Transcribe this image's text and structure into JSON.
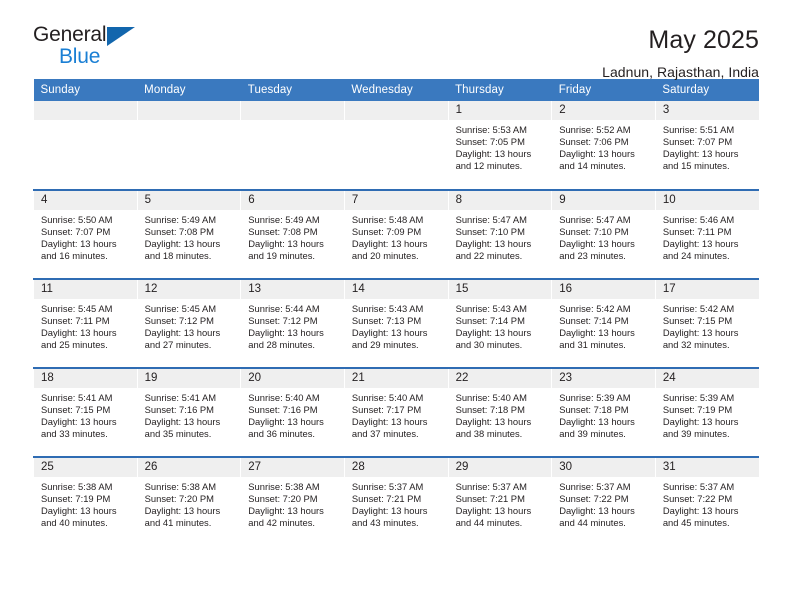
{
  "brand": {
    "name_part1": "General",
    "name_part2": "Blue",
    "accent_color": "#1a7fd4",
    "triangle_color": "#1266ad"
  },
  "header": {
    "title": "May 2025",
    "subtitle": "Ladnun, Rajasthan, India"
  },
  "theme": {
    "header_row_bg": "#3a79bf",
    "week_separator": "#2f6cb3",
    "daynum_bg": "#efefef",
    "text_color": "#231f20"
  },
  "weekday_headers": [
    "Sunday",
    "Monday",
    "Tuesday",
    "Wednesday",
    "Thursday",
    "Friday",
    "Saturday"
  ],
  "weeks": [
    {
      "days": [
        {
          "num": "",
          "sunrise": "",
          "sunset": "",
          "daylight": "",
          "empty": true
        },
        {
          "num": "",
          "sunrise": "",
          "sunset": "",
          "daylight": "",
          "empty": true
        },
        {
          "num": "",
          "sunrise": "",
          "sunset": "",
          "daylight": "",
          "empty": true
        },
        {
          "num": "",
          "sunrise": "",
          "sunset": "",
          "daylight": "",
          "empty": true
        },
        {
          "num": "1",
          "sunrise": "Sunrise: 5:53 AM",
          "sunset": "Sunset: 7:05 PM",
          "daylight": "Daylight: 13 hours and 12 minutes.",
          "empty": false
        },
        {
          "num": "2",
          "sunrise": "Sunrise: 5:52 AM",
          "sunset": "Sunset: 7:06 PM",
          "daylight": "Daylight: 13 hours and 14 minutes.",
          "empty": false
        },
        {
          "num": "3",
          "sunrise": "Sunrise: 5:51 AM",
          "sunset": "Sunset: 7:07 PM",
          "daylight": "Daylight: 13 hours and 15 minutes.",
          "empty": false
        }
      ]
    },
    {
      "days": [
        {
          "num": "4",
          "sunrise": "Sunrise: 5:50 AM",
          "sunset": "Sunset: 7:07 PM",
          "daylight": "Daylight: 13 hours and 16 minutes.",
          "empty": false
        },
        {
          "num": "5",
          "sunrise": "Sunrise: 5:49 AM",
          "sunset": "Sunset: 7:08 PM",
          "daylight": "Daylight: 13 hours and 18 minutes.",
          "empty": false
        },
        {
          "num": "6",
          "sunrise": "Sunrise: 5:49 AM",
          "sunset": "Sunset: 7:08 PM",
          "daylight": "Daylight: 13 hours and 19 minutes.",
          "empty": false
        },
        {
          "num": "7",
          "sunrise": "Sunrise: 5:48 AM",
          "sunset": "Sunset: 7:09 PM",
          "daylight": "Daylight: 13 hours and 20 minutes.",
          "empty": false
        },
        {
          "num": "8",
          "sunrise": "Sunrise: 5:47 AM",
          "sunset": "Sunset: 7:10 PM",
          "daylight": "Daylight: 13 hours and 22 minutes.",
          "empty": false
        },
        {
          "num": "9",
          "sunrise": "Sunrise: 5:47 AM",
          "sunset": "Sunset: 7:10 PM",
          "daylight": "Daylight: 13 hours and 23 minutes.",
          "empty": false
        },
        {
          "num": "10",
          "sunrise": "Sunrise: 5:46 AM",
          "sunset": "Sunset: 7:11 PM",
          "daylight": "Daylight: 13 hours and 24 minutes.",
          "empty": false
        }
      ]
    },
    {
      "days": [
        {
          "num": "11",
          "sunrise": "Sunrise: 5:45 AM",
          "sunset": "Sunset: 7:11 PM",
          "daylight": "Daylight: 13 hours and 25 minutes.",
          "empty": false
        },
        {
          "num": "12",
          "sunrise": "Sunrise: 5:45 AM",
          "sunset": "Sunset: 7:12 PM",
          "daylight": "Daylight: 13 hours and 27 minutes.",
          "empty": false
        },
        {
          "num": "13",
          "sunrise": "Sunrise: 5:44 AM",
          "sunset": "Sunset: 7:12 PM",
          "daylight": "Daylight: 13 hours and 28 minutes.",
          "empty": false
        },
        {
          "num": "14",
          "sunrise": "Sunrise: 5:43 AM",
          "sunset": "Sunset: 7:13 PM",
          "daylight": "Daylight: 13 hours and 29 minutes.",
          "empty": false
        },
        {
          "num": "15",
          "sunrise": "Sunrise: 5:43 AM",
          "sunset": "Sunset: 7:14 PM",
          "daylight": "Daylight: 13 hours and 30 minutes.",
          "empty": false
        },
        {
          "num": "16",
          "sunrise": "Sunrise: 5:42 AM",
          "sunset": "Sunset: 7:14 PM",
          "daylight": "Daylight: 13 hours and 31 minutes.",
          "empty": false
        },
        {
          "num": "17",
          "sunrise": "Sunrise: 5:42 AM",
          "sunset": "Sunset: 7:15 PM",
          "daylight": "Daylight: 13 hours and 32 minutes.",
          "empty": false
        }
      ]
    },
    {
      "days": [
        {
          "num": "18",
          "sunrise": "Sunrise: 5:41 AM",
          "sunset": "Sunset: 7:15 PM",
          "daylight": "Daylight: 13 hours and 33 minutes.",
          "empty": false
        },
        {
          "num": "19",
          "sunrise": "Sunrise: 5:41 AM",
          "sunset": "Sunset: 7:16 PM",
          "daylight": "Daylight: 13 hours and 35 minutes.",
          "empty": false
        },
        {
          "num": "20",
          "sunrise": "Sunrise: 5:40 AM",
          "sunset": "Sunset: 7:16 PM",
          "daylight": "Daylight: 13 hours and 36 minutes.",
          "empty": false
        },
        {
          "num": "21",
          "sunrise": "Sunrise: 5:40 AM",
          "sunset": "Sunset: 7:17 PM",
          "daylight": "Daylight: 13 hours and 37 minutes.",
          "empty": false
        },
        {
          "num": "22",
          "sunrise": "Sunrise: 5:40 AM",
          "sunset": "Sunset: 7:18 PM",
          "daylight": "Daylight: 13 hours and 38 minutes.",
          "empty": false
        },
        {
          "num": "23",
          "sunrise": "Sunrise: 5:39 AM",
          "sunset": "Sunset: 7:18 PM",
          "daylight": "Daylight: 13 hours and 39 minutes.",
          "empty": false
        },
        {
          "num": "24",
          "sunrise": "Sunrise: 5:39 AM",
          "sunset": "Sunset: 7:19 PM",
          "daylight": "Daylight: 13 hours and 39 minutes.",
          "empty": false
        }
      ]
    },
    {
      "days": [
        {
          "num": "25",
          "sunrise": "Sunrise: 5:38 AM",
          "sunset": "Sunset: 7:19 PM",
          "daylight": "Daylight: 13 hours and 40 minutes.",
          "empty": false
        },
        {
          "num": "26",
          "sunrise": "Sunrise: 5:38 AM",
          "sunset": "Sunset: 7:20 PM",
          "daylight": "Daylight: 13 hours and 41 minutes.",
          "empty": false
        },
        {
          "num": "27",
          "sunrise": "Sunrise: 5:38 AM",
          "sunset": "Sunset: 7:20 PM",
          "daylight": "Daylight: 13 hours and 42 minutes.",
          "empty": false
        },
        {
          "num": "28",
          "sunrise": "Sunrise: 5:37 AM",
          "sunset": "Sunset: 7:21 PM",
          "daylight": "Daylight: 13 hours and 43 minutes.",
          "empty": false
        },
        {
          "num": "29",
          "sunrise": "Sunrise: 5:37 AM",
          "sunset": "Sunset: 7:21 PM",
          "daylight": "Daylight: 13 hours and 44 minutes.",
          "empty": false
        },
        {
          "num": "30",
          "sunrise": "Sunrise: 5:37 AM",
          "sunset": "Sunset: 7:22 PM",
          "daylight": "Daylight: 13 hours and 44 minutes.",
          "empty": false
        },
        {
          "num": "31",
          "sunrise": "Sunrise: 5:37 AM",
          "sunset": "Sunset: 7:22 PM",
          "daylight": "Daylight: 13 hours and 45 minutes.",
          "empty": false
        }
      ]
    }
  ]
}
